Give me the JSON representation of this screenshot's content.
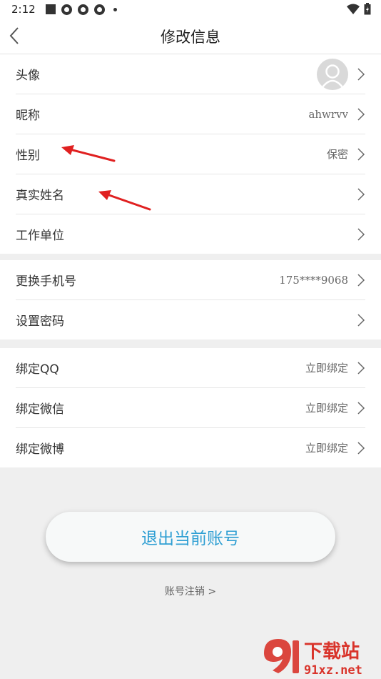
{
  "status_bar": {
    "time": "2:12"
  },
  "header": {
    "title": "修改信息"
  },
  "group1": {
    "avatar_label": "头像",
    "nickname": {
      "label": "昵称",
      "value": "ahwrvv"
    },
    "gender": {
      "label": "性别",
      "value": "保密"
    },
    "real_name": {
      "label": "真实姓名"
    },
    "work_unit": {
      "label": "工作单位"
    }
  },
  "group2": {
    "phone": {
      "label": "更换手机号",
      "value": "175****9068"
    },
    "password": {
      "label": "设置密码"
    }
  },
  "group3": {
    "qq": {
      "label": "绑定QQ",
      "value": "立即绑定"
    },
    "wechat": {
      "label": "绑定微信",
      "value": "立即绑定"
    },
    "weibo": {
      "label": "绑定微博",
      "value": "立即绑定"
    }
  },
  "actions": {
    "logout_label": "退出当前账号",
    "cancel_account_label": "账号注销 >"
  },
  "watermark": {
    "brand": "下载站",
    "domain": "91xz.net"
  },
  "colors": {
    "accent": "#2f9fd3",
    "annotation_arrow": "#e02020",
    "watermark": "#d9342b"
  }
}
